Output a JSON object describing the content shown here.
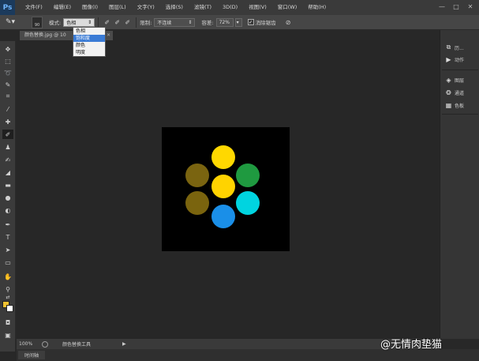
{
  "app": {
    "logo": "Ps"
  },
  "menu": [
    "文件(F)",
    "编辑(E)",
    "图像(I)",
    "图层(L)",
    "文字(Y)",
    "选择(S)",
    "滤镜(T)",
    "3D(D)",
    "视图(V)",
    "窗口(W)",
    "帮助(H)"
  ],
  "window_controls": {
    "minimize": "—",
    "restore": "□",
    "close": "✕"
  },
  "options": {
    "brush_size": "90",
    "mode_label": "模式:",
    "mode_value": "色相",
    "limit_label": "限制:",
    "limit_value": "不连续",
    "tolerance_label": "容差:",
    "tolerance_value": "72%",
    "antialias_label": "消除锯齿"
  },
  "mode_dropdown": {
    "options": [
      "色相",
      "饱和度",
      "颜色",
      "明度"
    ],
    "highlighted_index": 1
  },
  "document_tab": {
    "title": "颜色替换.jpg @ 10",
    "close": "✕"
  },
  "right_dock": [
    {
      "icon": "history-icon",
      "glyph": "⧉",
      "label": "历..."
    },
    {
      "icon": "actions-icon",
      "glyph": "▶",
      "label": "动作"
    },
    {
      "icon": "layers-icon",
      "glyph": "◈",
      "label": "图层"
    },
    {
      "icon": "channels-icon",
      "glyph": "❂",
      "label": "通道"
    },
    {
      "icon": "swatches-icon",
      "glyph": "▦",
      "label": "色板"
    }
  ],
  "status": {
    "zoom": "100%",
    "tool_name": "颜色替换工具",
    "arrow": "▶"
  },
  "timeline": {
    "tab_label": "时间轴"
  },
  "colors": {
    "foreground": "#f1c232",
    "background": "#ffffff"
  },
  "canvas_circles": [
    {
      "color": "#ffd800",
      "name": "yellow-top"
    },
    {
      "color": "#7a6410",
      "name": "olive-left-top"
    },
    {
      "color": "#1f9a40",
      "name": "green-right"
    },
    {
      "color": "#ffd300",
      "name": "yellow-center"
    },
    {
      "color": "#7a640e",
      "name": "olive-left-bottom"
    },
    {
      "color": "#00d4e0",
      "name": "cyan-right"
    },
    {
      "color": "#1a8fe8",
      "name": "blue-bottom"
    }
  ],
  "watermark": {
    "text": "@无情肉垫猫"
  }
}
